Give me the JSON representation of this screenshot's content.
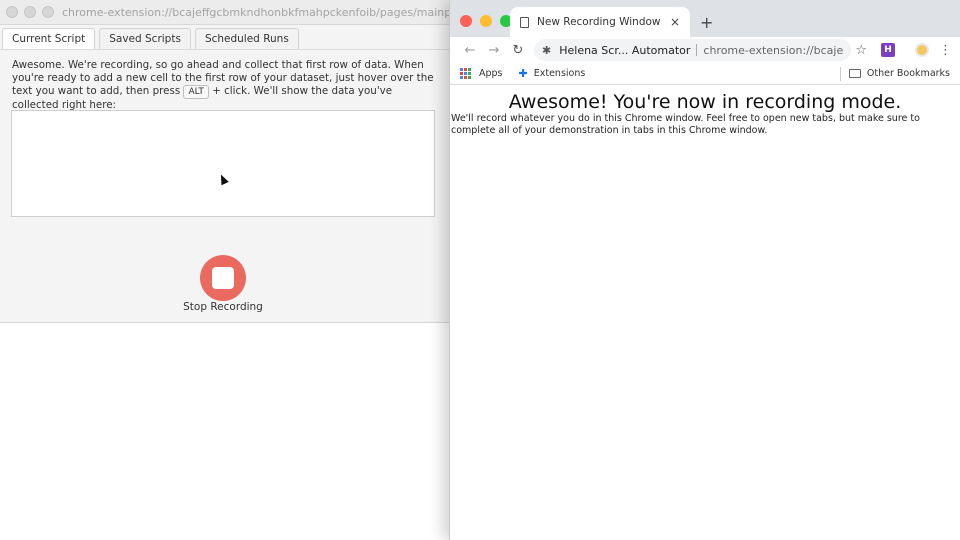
{
  "left_window": {
    "url": "chrome-extension://bcajeffgcbmkndhonbkfmahpckenfoib/pages/mainpanel.html",
    "tabs": [
      {
        "label": "Current Script",
        "active": true
      },
      {
        "label": "Saved Scripts",
        "active": false
      },
      {
        "label": "Scheduled Runs",
        "active": false
      }
    ],
    "instructions_before": "Awesome. We're recording, so go ahead and collect that first row of data. When you're ready to add a new cell to the first row of your dataset, just hover over the text you want to add, then press",
    "key_label": "ALT",
    "instructions_after": "+ click. We'll show the data you've collected right here:",
    "stop_label": "Stop Recording",
    "stop_color": "#ea6a60"
  },
  "browser": {
    "tab_title": "New Recording Window",
    "tab_close": "×",
    "new_tab": "+",
    "site_name": "Helena Scr... Automator",
    "url": "chrome-extension://bcajeffgcbmkndhonbkfmahpckenfoib",
    "extension_badge": "H",
    "bookmarks": {
      "apps": "Apps",
      "extensions": "Extensions",
      "other": "Other Bookmarks"
    },
    "heading": "Awesome! You're now in recording mode.",
    "body": "We'll record whatever you do in this Chrome window. Feel free to open new tabs, but make sure to complete all of your demonstration in tabs in this Chrome window."
  }
}
